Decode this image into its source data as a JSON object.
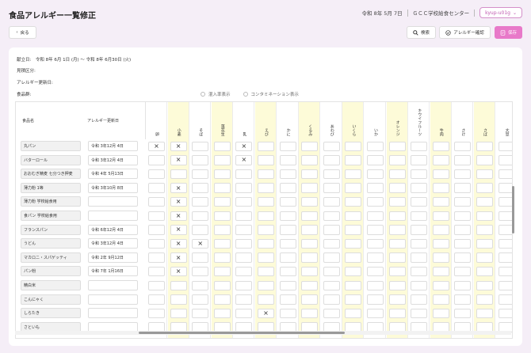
{
  "header": {
    "title": "食品アレルギー一覧修正",
    "date": "令和 8年 5月 7日",
    "center": "ＧＣＣ学校給食センター",
    "user": "kyup-u01g"
  },
  "toolbar": {
    "back_label": "戻る",
    "search_label": "検索",
    "check_label": "アレルギー確認",
    "save_label": "保存"
  },
  "info": {
    "period": "献立日:　令和 8年 6月 1日 (月) ～ 令和 8年 6月30日 (火)",
    "fixed_class": "見積区分:",
    "allergy_update": "アレルギー更新日:",
    "food_section": "食品群:"
  },
  "display_options": [
    "混入率表示",
    "コンタミネーション表示"
  ],
  "table": {
    "col_name": "食品名",
    "col_date": "アレルギー更新日",
    "allergens": [
      "卵",
      "小麦",
      "そば",
      "落花生",
      "乳",
      "えび",
      "かに",
      "くるみ",
      "あわび",
      "いくら",
      "いか",
      "オレンジ",
      "キウイフルーツ",
      "牛肉",
      "さけ",
      "さば",
      "大豆"
    ],
    "rows": [
      {
        "name": "丸パン",
        "date": "令和 3年12月 4日",
        "marks": [
          "卵",
          "小麦",
          "乳"
        ]
      },
      {
        "name": "バターロール",
        "date": "令和 3年12月 4日",
        "marks": [
          "小麦",
          "乳"
        ]
      },
      {
        "name": "おおむぎ精麦 七分つき押麦",
        "date": "令和 4年 5月13日",
        "marks": []
      },
      {
        "name": "薄力粉 1等",
        "date": "令和 3年10月 8日",
        "marks": [
          "小麦"
        ]
      },
      {
        "name": "薄力粉 学校給食用",
        "date": "",
        "marks": [
          "小麦"
        ]
      },
      {
        "name": "食パン 学校給食用",
        "date": "",
        "marks": [
          "小麦"
        ]
      },
      {
        "name": "フランスパン",
        "date": "令和 6年12月 4日",
        "marks": [
          "小麦"
        ]
      },
      {
        "name": "うどん",
        "date": "令和 3年12月 4日",
        "marks": [
          "小麦",
          "そば"
        ]
      },
      {
        "name": "マカロニ・スパゲッティ",
        "date": "令和 2年 9月12日",
        "marks": [
          "小麦"
        ]
      },
      {
        "name": "パン粉",
        "date": "令和 7年 1月16日",
        "marks": [
          "小麦"
        ]
      },
      {
        "name": "精白米",
        "date": "",
        "marks": []
      },
      {
        "name": "こんにゃく",
        "date": "",
        "marks": []
      },
      {
        "name": "しらたき",
        "date": "",
        "marks": [
          "えび"
        ]
      },
      {
        "name": "さといも",
        "date": "",
        "marks": []
      }
    ]
  },
  "mark_symbol": "×",
  "icons": [
    "chevron-left-icon",
    "search-icon",
    "check-circle-icon",
    "save-icon",
    "chevron-down-icon"
  ],
  "colors": {
    "accent": "#e879c9",
    "highlight_column": "#fdfbd8",
    "background": "#f5eef7"
  }
}
